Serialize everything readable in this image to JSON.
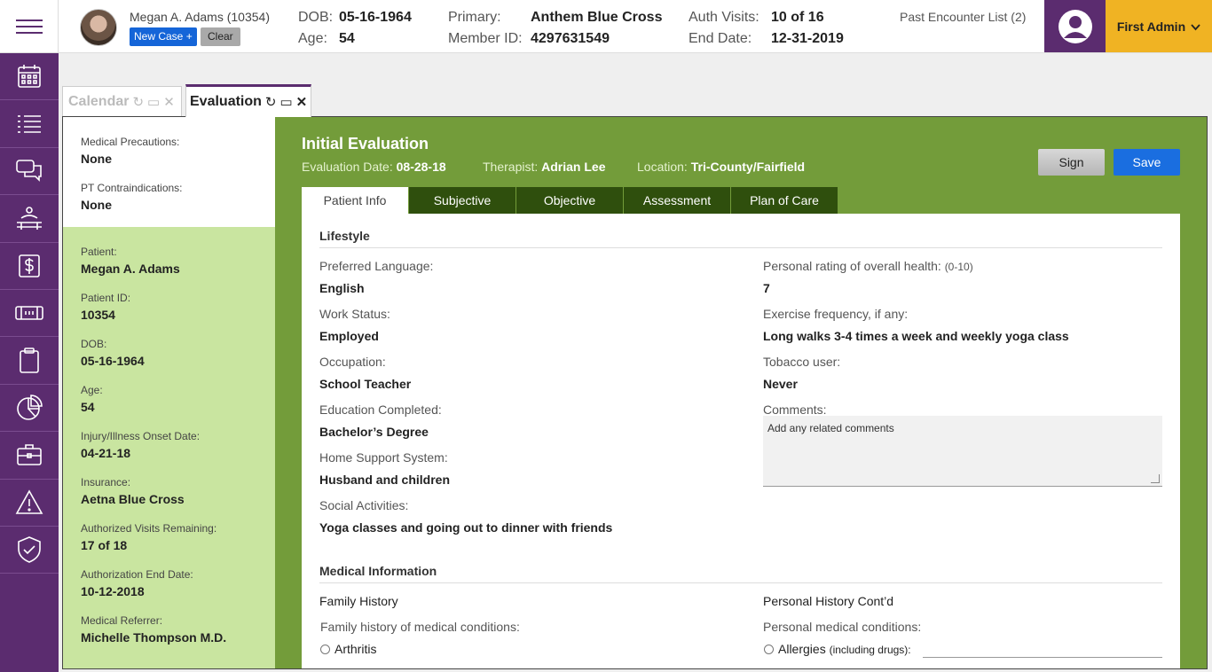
{
  "header": {
    "patient_name": "Megan A. Adams (10354)",
    "new_case_label": "New Case +",
    "clear_label": "Clear",
    "dob_label": "DOB:",
    "dob_value": "05-16-1964",
    "age_label": "Age:",
    "age_value": "54",
    "primary_label": "Primary:",
    "primary_value": "Anthem Blue Cross",
    "member_label": "Member ID:",
    "member_value": "4297631549",
    "auth_label": "Auth Visits:",
    "auth_value": "10 of 16",
    "end_label": "End Date:",
    "end_value": "12-31-2019",
    "past_encounters": "Past Encounter List (2)",
    "user_name": "First Admin"
  },
  "tabs": {
    "calendar": "Calendar",
    "evaluation": "Evaluation"
  },
  "left_top": {
    "precautions_label": "Medical Precautions:",
    "precautions_value": "None",
    "contra_label": "PT Contraindications:",
    "contra_value": "None"
  },
  "left_info": [
    {
      "label": "Patient:",
      "value": "Megan A. Adams"
    },
    {
      "label": "Patient ID:",
      "value": "10354"
    },
    {
      "label": "DOB:",
      "value": "05-16-1964"
    },
    {
      "label": "Age:",
      "value": "54"
    },
    {
      "label": "Injury/Illness Onset Date:",
      "value": "04-21-18"
    },
    {
      "label": "Insurance:",
      "value": "Aetna Blue Cross"
    },
    {
      "label": "Authorized Visits Remaining:",
      "value": "17 of 18"
    },
    {
      "label": "Authorization End Date:",
      "value": "10-12-2018"
    },
    {
      "label": "Medical Referrer:",
      "value": "Michelle Thompson M.D."
    }
  ],
  "evaluation": {
    "title": "Initial Evaluation",
    "date_label": "Evaluation Date:",
    "date_value": "08-28-18",
    "therapist_label": "Therapist:",
    "therapist_value": "Adrian Lee",
    "location_label": "Location:",
    "location_value": "Tri-County/Fairfield",
    "sign_label": "Sign",
    "save_label": "Save",
    "subtabs": [
      "Patient Info",
      "Subjective",
      "Objective",
      "Assessment",
      "Plan of Care"
    ]
  },
  "lifestyle": {
    "title": "Lifestyle",
    "preferred_language_label": "Preferred Language:",
    "preferred_language": "English",
    "work_status_label": "Work Status:",
    "work_status": "Employed",
    "occupation_label": "Occupation:",
    "occupation": "School Teacher",
    "education_label": "Education Completed:",
    "education": "Bachelor’s Degree",
    "home_support_label": "Home Support System:",
    "home_support": "Husband and children",
    "social_label": "Social Activities:",
    "social": "Yoga classes and going out to dinner with friends",
    "health_rating_label": "Personal rating of overall health:",
    "health_rating_range": "(0-10)",
    "health_rating": "7",
    "exercise_label": "Exercise frequency, if any:",
    "exercise": "Long walks 3-4 times a week and weekly yoga class",
    "tobacco_label": "Tobacco user:",
    "tobacco": "Never",
    "comments_label": "Comments:",
    "comments_placeholder": "Add any related comments"
  },
  "medical": {
    "title": "Medical Information",
    "family_history_title": "Family History",
    "family_conditions_label": "Family history of medical conditions:",
    "arthritis_label": "Arthritis",
    "personal_history_title": "Personal History Cont’d",
    "personal_conditions_label": "Personal medical conditions:",
    "allergies_label": "Allergies",
    "allergies_note": "(including drugs):"
  }
}
